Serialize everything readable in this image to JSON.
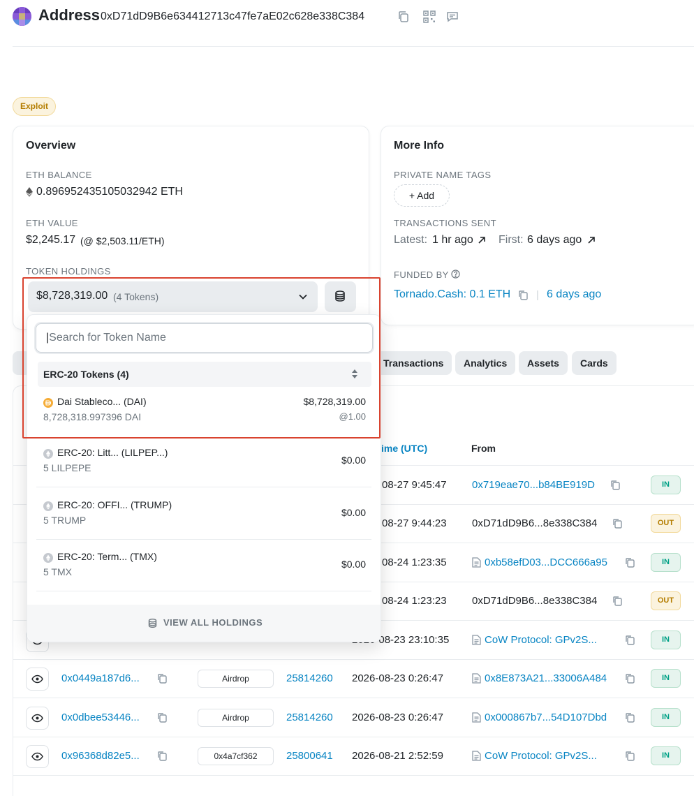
{
  "header": {
    "title": "Address",
    "address": "0xD71dD9B6e634412713c47fe7aE02c628e338C384"
  },
  "tag": "Exploit",
  "overview": {
    "title": "Overview",
    "eth_balance_label": "ETH BALANCE",
    "eth_balance": "0.896952435105032942 ETH",
    "eth_value_label": "ETH VALUE",
    "eth_value": "$2,245.17",
    "eth_price": "(@ $2,503.11/ETH)",
    "token_holdings_label": "TOKEN HOLDINGS",
    "token_total": "$8,728,319.00",
    "token_count": "(4 Tokens)"
  },
  "more_info": {
    "title": "More Info",
    "private_tags_label": "PRIVATE NAME TAGS",
    "add_label": "+ Add",
    "tx_sent_label": "TRANSACTIONS SENT",
    "latest_label": "Latest:",
    "latest_value": "1 hr ago",
    "first_label": "First:",
    "first_value": "6 days ago",
    "funded_by_label": "FUNDED BY",
    "funded_by_value": "Tornado.Cash: 0.1 ETH",
    "funded_separator": "|",
    "funded_time": "6 days ago"
  },
  "tabs": [
    "Transactions",
    "Analytics",
    "Assets",
    "Cards"
  ],
  "table": {
    "col_time": "ime (UTC)",
    "col_from": "From",
    "rows": [
      {
        "hash": "",
        "method": "",
        "block": "",
        "time": "08-27 9:45:47",
        "from": "0x719eae70...b84BE919D",
        "from_link": true,
        "contract": false,
        "dir": "IN"
      },
      {
        "hash": "",
        "method": "",
        "block": "",
        "time": "08-27 9:44:23",
        "from": "0xD71dD9B6...8e338C384",
        "from_link": false,
        "contract": false,
        "dir": "OUT"
      },
      {
        "hash": "",
        "method": "",
        "block": "",
        "time": "08-24 1:23:35",
        "from": "0xb58efD03...DCC666a95",
        "from_link": true,
        "contract": true,
        "dir": "IN"
      },
      {
        "hash": "",
        "method": "",
        "block": "",
        "time": "08-24 1:23:23",
        "from": "0xD71dD9B6...8e338C384",
        "from_link": false,
        "contract": false,
        "dir": "OUT"
      },
      {
        "hash": "",
        "method": "",
        "block": "",
        "time": "2026-08-23 23:10:35",
        "from": "CoW Protocol: GPv2S...",
        "from_link": true,
        "contract": true,
        "dir": "IN"
      },
      {
        "hash": "0x0449a187d6...",
        "method": "Airdrop",
        "block": "25814260",
        "time": "2026-08-23 0:26:47",
        "from": "0x8E873A21...33006A484",
        "from_link": true,
        "contract": true,
        "dir": "IN"
      },
      {
        "hash": "0x0dbee53446...",
        "method": "Airdrop",
        "block": "25814260",
        "time": "2026-08-23 0:26:47",
        "from": "0x000867b7...54D107Dbd",
        "from_link": true,
        "contract": true,
        "dir": "IN"
      },
      {
        "hash": "0x96368d82e5...",
        "method": "0x4a7cf362",
        "block": "25800641",
        "time": "2026-08-21 2:52:59",
        "from": "CoW Protocol: GPv2S...",
        "from_link": true,
        "contract": true,
        "dir": "IN"
      }
    ]
  },
  "dropdown": {
    "search_placeholder": "Search for Token Name",
    "group_title": "ERC-20 Tokens (4)",
    "tokens": [
      {
        "name": "Dai Stableco... (DAI)",
        "amount": "8,728,318.997396 DAI",
        "value": "$8,728,319.00",
        "rate": "@1.00",
        "icon": "dai-coin-icon"
      },
      {
        "name": "ERC-20: Litt... (LILPEP...)",
        "amount": "5 LILPEPE",
        "value": "$0.00",
        "rate": "",
        "icon": "eth-token-icon"
      },
      {
        "name": "ERC-20: OFFI... (TRUMP)",
        "amount": "5 TRUMP",
        "value": "$0.00",
        "rate": "",
        "icon": "eth-token-icon"
      },
      {
        "name": "ERC-20: Term... (TMX)",
        "amount": "5 TMX",
        "value": "$0.00",
        "rate": "",
        "icon": "eth-token-icon"
      }
    ],
    "footer_label": "VIEW ALL HOLDINGS"
  },
  "colors": {
    "link": "#0784c3",
    "highlight": "#d9432f",
    "in_badge": "#00a186",
    "out_badge": "#b47d00"
  }
}
